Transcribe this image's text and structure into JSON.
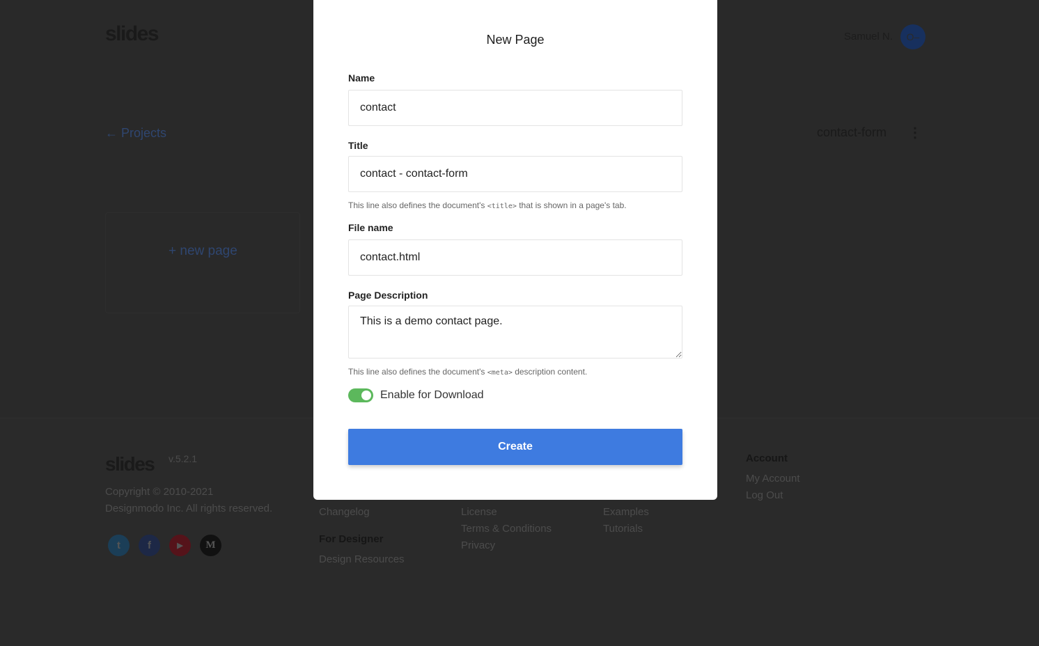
{
  "header": {
    "logo": "slides",
    "user_name": "Samuel N.",
    "avatar_icon": "user-avatar-icon"
  },
  "nav": {
    "back_label": "Projects",
    "back_icon": "arrow-left-icon",
    "project_name": "contact-form",
    "menu_icon": "kebab-menu-icon"
  },
  "main": {
    "new_page_label": "+ new page"
  },
  "footer": {
    "logo": "slides",
    "version": "v.5.2.1",
    "copyright_line1": "Copyright © 2010-2021",
    "copyright_line2": "Designmodo Inc. All rights reserved.",
    "social": [
      {
        "icon": "twitter-icon",
        "glyph": "t",
        "color": "#1da1f2"
      },
      {
        "icon": "facebook-icon",
        "glyph": "f",
        "color": "#3b5998"
      },
      {
        "icon": "youtube-icon",
        "glyph": "▶",
        "color": "#e62117"
      },
      {
        "icon": "medium-icon",
        "glyph": "M",
        "color": "#111111"
      }
    ],
    "col1": {
      "links": [
        "Changelog"
      ],
      "heading2": "For Designer",
      "links2": [
        "Design Resources"
      ]
    },
    "col2": {
      "links": [
        "License",
        "Terms & Conditions",
        "Privacy"
      ]
    },
    "col3": {
      "links": [
        "Examples",
        "Tutorials"
      ]
    },
    "col4": {
      "heading": "Account",
      "links": [
        "My Account",
        "Log Out"
      ]
    }
  },
  "modal": {
    "title": "New Page",
    "name_label": "Name",
    "name_value": "contact",
    "title_label": "Title",
    "title_value": "contact - contact-form",
    "title_help_pre": "This line also defines the document's ",
    "title_help_code": "<title>",
    "title_help_post": " that is shown in a page's tab.",
    "file_label": "File name",
    "file_value": "contact.html",
    "desc_label": "Page Description",
    "desc_value": "This is a demo contact page.",
    "desc_help_pre": "This line also defines the document's ",
    "desc_help_code": "<meta>",
    "desc_help_post": " description content.",
    "download_label": "Enable for Download",
    "download_enabled": true,
    "create_label": "Create"
  },
  "colors": {
    "accent": "#3e7be0",
    "toggle_on": "#5cb85c"
  }
}
